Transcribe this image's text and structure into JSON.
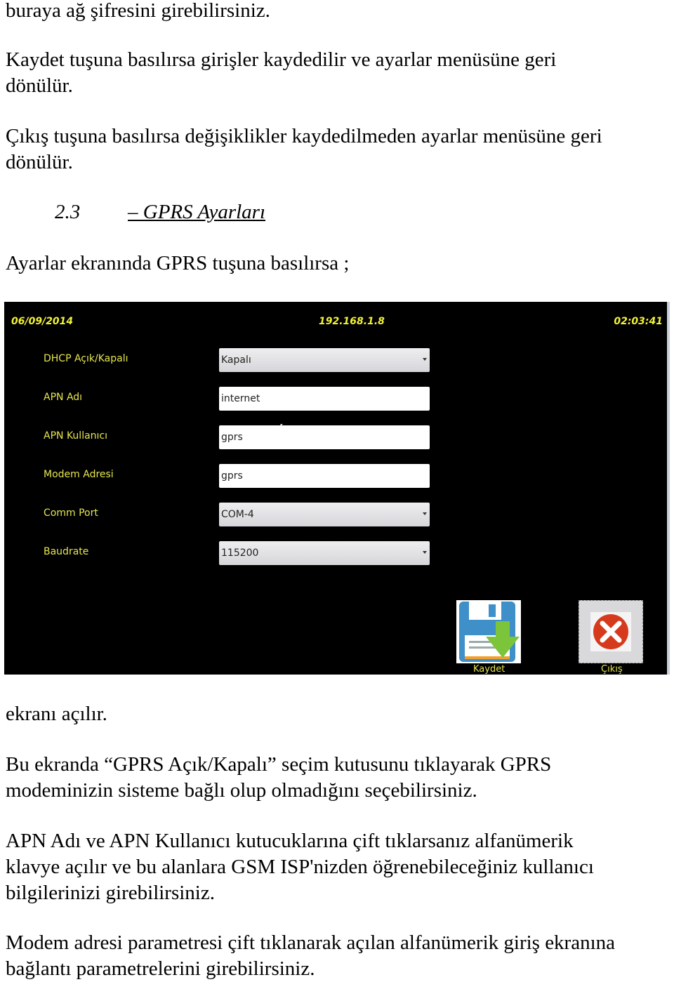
{
  "document": {
    "paragraphs_top": [
      "buraya ağ şifresini girebilirsiniz.",
      "Kaydet tuşuna basılırsa girişler kaydedilir ve ayarlar menüsüne geri",
      "dönülür.",
      "Çıkış tuşuna basılırsa değişiklikler kaydedilmeden ayarlar menüsüne geri",
      "dönülür."
    ],
    "section": {
      "number": "2.3",
      "title": "– GPRS Ayarları"
    },
    "intro": "Ayarlar ekranında GPRS tuşuna basılırsa ;",
    "after_screenshot": "ekranı açılır.",
    "paragraphs_bottom": [
      "Bu ekranda “GPRS Açık/Kapalı” seçim kutusunu tıklayarak GPRS",
      "modeminizin sisteme bağlı olup olmadığını seçebilirsiniz.",
      "APN Adı ve APN Kullanıcı kutucuklarına çift tıklarsanız alfanümerik",
      "klavye açılır ve bu alanlara GSM ISP'nizden öğrenebileceğiniz kullanıcı",
      "bilgilerinizi girebilirsiniz.",
      "Modem adresi parametresi çift tıklanarak açılan alfanümerik giriş ekranına",
      "bağlantı parametrelerini girebilirsiniz."
    ]
  },
  "screen": {
    "date": "06/09/2014",
    "ip": "192.168.1.8",
    "time": "02:03:41",
    "rows": [
      {
        "label": "DHCP Açık/Kapalı",
        "value": "Kapalı",
        "type": "select"
      },
      {
        "label": "APN Adı",
        "value": "internet",
        "type": "input"
      },
      {
        "label": "APN Kullanıcı",
        "value": "gprs",
        "type": "input"
      },
      {
        "label": "Modem Adresi",
        "value": "gprs",
        "type": "input"
      },
      {
        "label": "Comm Port",
        "value": "COM-4",
        "type": "select"
      },
      {
        "label": "Baudrate",
        "value": "115200",
        "type": "select"
      }
    ],
    "save_label": "Kaydet",
    "exit_label": "Çıkış",
    "colors": {
      "background": "#000000",
      "label": "#e6e650",
      "header": "#f2f23a"
    }
  }
}
